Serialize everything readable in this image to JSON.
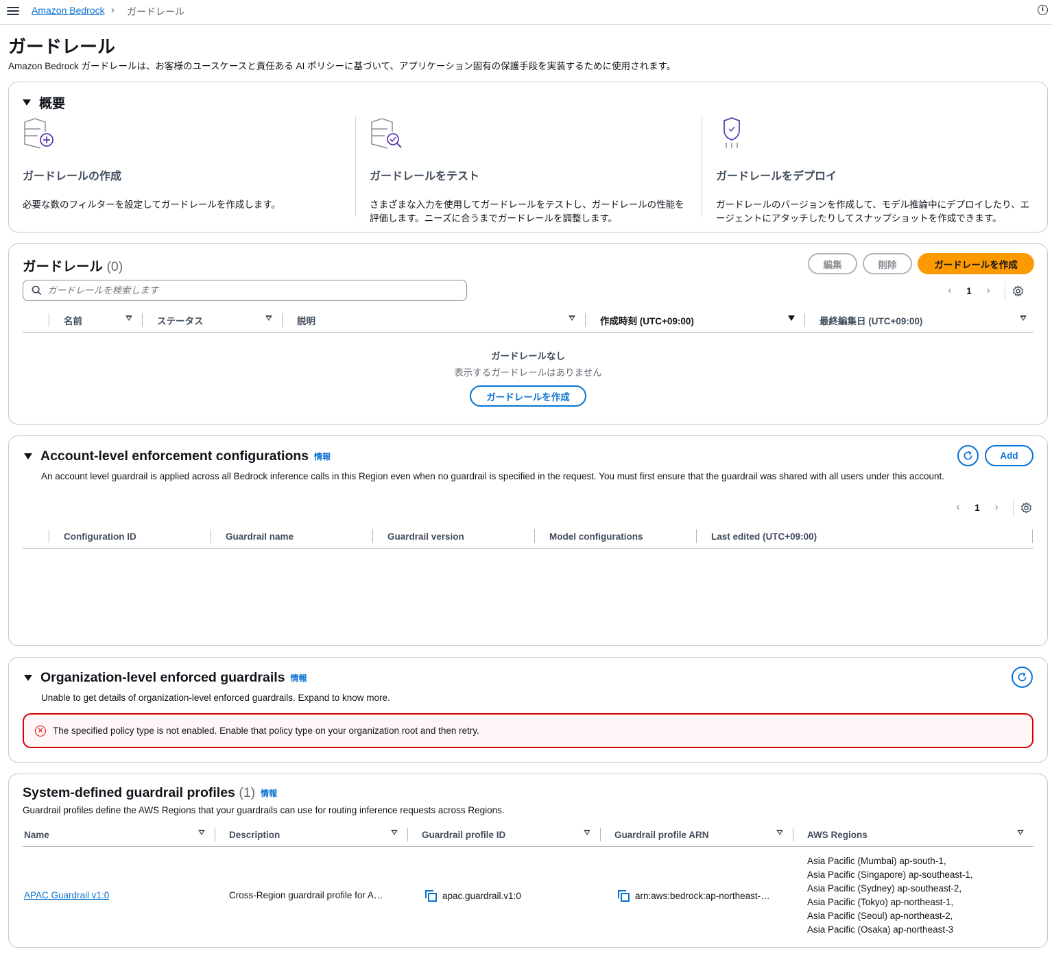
{
  "breadcrumb": {
    "parent": "Amazon Bedrock",
    "current": "ガードレール"
  },
  "page": {
    "title": "ガードレール",
    "description": "Amazon Bedrock ガードレールは、お客様のユースケースと責任ある AI ポリシーに基づいて、アプリケーション固有の保護手段を実装するために使用されます。"
  },
  "overview": {
    "title": "概要",
    "cards": [
      {
        "icon": "shield-plus-icon",
        "title": "ガードレールの作成",
        "text": "必要な数のフィルターを設定してガードレールを作成します。"
      },
      {
        "icon": "shield-search-icon",
        "title": "ガードレールをテスト",
        "text": "さまざまな入力を使用してガードレールをテストし、ガードレールの性能を評価します。ニーズに合うまでガードレールを調整します。"
      },
      {
        "icon": "shield-deploy-icon",
        "title": "ガードレールをデプロイ",
        "text": "ガードレールのバージョンを作成して、モデル推論中にデプロイしたり、エージェントにアタッチしたりしてスナップショットを作成できます。"
      }
    ]
  },
  "guardrails": {
    "title": "ガードレール",
    "count": "(0)",
    "edit_label": "編集",
    "delete_label": "削除",
    "create_label": "ガードレールを作成",
    "search_placeholder": "ガードレールを検索します",
    "page": "1",
    "columns": [
      "名前",
      "ステータス",
      "説明",
      "作成時刻 (UTC+09:00)",
      "最終編集日 (UTC+09:00)"
    ],
    "empty_title": "ガードレールなし",
    "empty_sub": "表示するガードレールはありません",
    "empty_create_label": "ガードレールを作成"
  },
  "account_level": {
    "title": "Account-level enforcement configurations",
    "info": "情報",
    "add_label": "Add",
    "description": "An account level guardrail is applied across all Bedrock inference calls in this Region even when no guardrail is specified in the request. You must first ensure that the guardrail was shared with all users under this account.",
    "page": "1",
    "columns": [
      "Configuration ID",
      "Guardrail name",
      "Guardrail version",
      "Model configurations",
      "Last edited (UTC+09:00)"
    ]
  },
  "org_level": {
    "title": "Organization-level enforced guardrails",
    "info": "情報",
    "description": "Unable to get details of organization-level enforced guardrails. Expand to know more.",
    "error": "The specified policy type is not enabled. Enable that policy type on your organization root and then retry."
  },
  "system_profiles": {
    "title": "System-defined guardrail profiles",
    "count": "(1)",
    "info": "情報",
    "description": "Guardrail profiles define the AWS Regions that your guardrails can use for routing inference requests across Regions.",
    "columns": [
      "Name",
      "Description",
      "Guardrail profile ID",
      "Guardrail profile ARN",
      "AWS Regions"
    ],
    "rows": [
      {
        "name": "APAC Guardrail v1:0",
        "description": "Cross-Region guardrail profile for A…",
        "profile_id": "apac.guardrail.v1:0",
        "arn": "arn:aws:bedrock:ap-northeast-…",
        "regions": [
          "Asia Pacific (Mumbai) ap-south-1,",
          "Asia Pacific (Singapore) ap-southeast-1,",
          "Asia Pacific (Sydney) ap-southeast-2,",
          "Asia Pacific (Tokyo) ap-northeast-1,",
          "Asia Pacific (Seoul) ap-northeast-2,",
          "Asia Pacific (Osaka) ap-northeast-3"
        ]
      }
    ]
  },
  "colors": {
    "link": "#0972d3",
    "primary": "#ff9900",
    "error": "#db0000",
    "border": "#c6c6cd"
  }
}
